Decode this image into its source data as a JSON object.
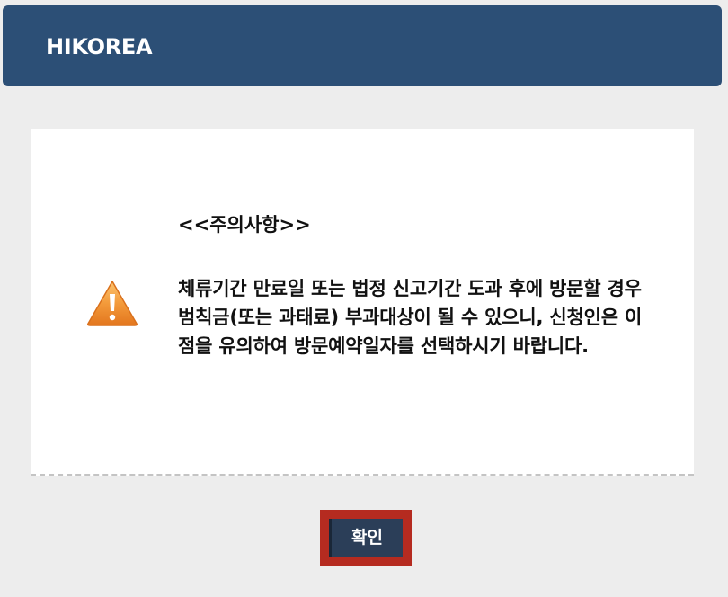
{
  "header": {
    "title": "HIKOREA"
  },
  "notice": {
    "icon": "warning-icon",
    "heading": "<<주의사항>>",
    "body": "체류기간 만료일 또는 법정 신고기간 도과 후에 방문할 경우 범칙금(또는 과태료) 부과대상이 될 수 있으니, 신청인은 이점을 유의하여 방문예약일자를 선택하시기 바랍니다."
  },
  "actions": {
    "confirm_label": "확인"
  },
  "colors": {
    "header_bg": "#2c4f76",
    "confirm_bg": "#2b3e58",
    "highlight_frame": "#b52b20",
    "warning_orange": "#f08a2a"
  }
}
